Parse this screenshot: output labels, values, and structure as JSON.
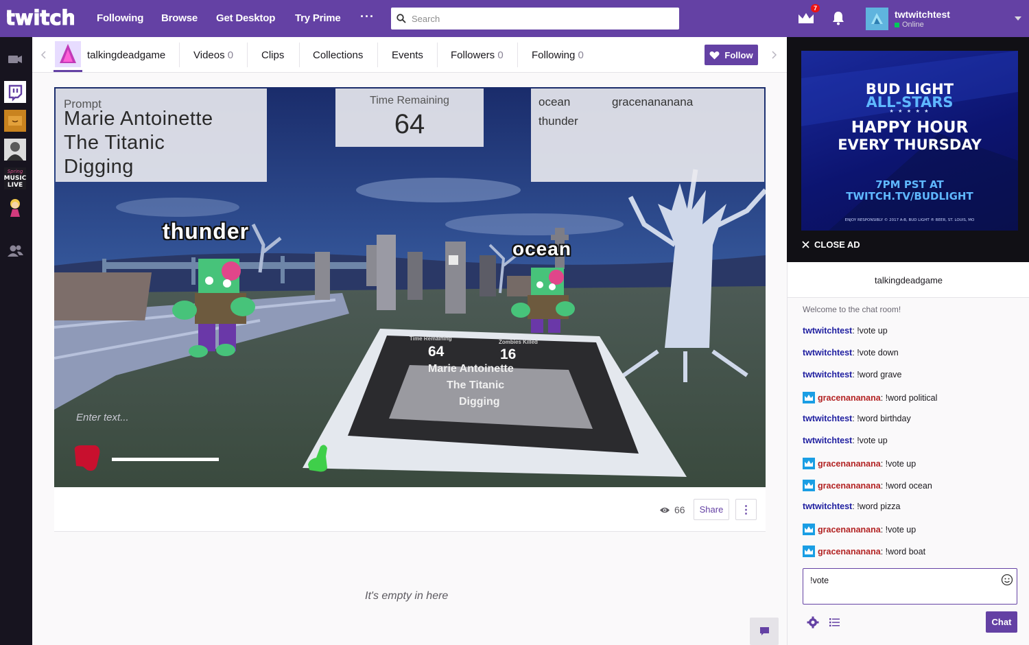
{
  "topnav": {
    "logo_text": "twitch",
    "links": [
      "Following",
      "Browse",
      "Get Desktop",
      "Try Prime"
    ],
    "more": "···",
    "search_placeholder": "Search",
    "notification_count": "7",
    "username": "twtwitchtest",
    "status": "Online"
  },
  "rail": {
    "items": [
      "video-camera-icon",
      "twitch-glitch-icon",
      "channel-avatar-1",
      "channel-avatar-2",
      "music-live-avatar",
      "channel-avatar-3",
      "friends-icon"
    ],
    "music_live_text": [
      "Spring",
      "MUSIC",
      "LIVE"
    ]
  },
  "channel": {
    "name": "talkingdeadgame",
    "tabs": [
      {
        "label": "Videos",
        "count": "0"
      },
      {
        "label": "Clips",
        "count": ""
      },
      {
        "label": "Collections",
        "count": ""
      },
      {
        "label": "Events",
        "count": ""
      },
      {
        "label": "Followers",
        "count": "0"
      },
      {
        "label": "Following",
        "count": "0"
      }
    ],
    "follow_label": "Follow"
  },
  "game": {
    "prompt_label": "Prompt",
    "prompt_lines": [
      "Marie Antoinette",
      "The Titanic",
      "Digging"
    ],
    "time_label": "Time Remaining",
    "time_value": "64",
    "players": [
      "ocean",
      "gracenananana",
      "thunder"
    ],
    "word_left": "thunder",
    "word_right": "ocean",
    "board": {
      "time_label": "Time Remaining",
      "kills_label": "Zombies Killed",
      "time_value": "64",
      "kills_value": "16",
      "lines": [
        "Marie Antoinette",
        "The Titanic",
        "Digging"
      ]
    },
    "enter_placeholder": "Enter text..."
  },
  "player_bar": {
    "viewers": "66",
    "share_label": "Share",
    "more_label": "⋮"
  },
  "below_player": {
    "empty_text": "It's empty in here"
  },
  "ad": {
    "line1": "BUD LIGHT",
    "line2": "ALL-STARS",
    "stars": "★ ★ ★ ★ ★",
    "line3": "HAPPY HOUR",
    "line4": "EVERY THURSDAY",
    "line5": "7PM PST AT",
    "line6": "TWITCH.TV/BUDLIGHT",
    "fine_print": "ENJOY RESPONSIBLY © 2017 A-B, BUD LIGHT ® BEER, ST. LOUIS, MO",
    "close_label": "CLOSE AD"
  },
  "chat": {
    "title": "talkingdeadgame",
    "welcome": "Welcome to the chat room!",
    "messages": [
      {
        "user": "twtwitchtest",
        "text": "!vote up",
        "badge": false,
        "color": "#1e1ea0"
      },
      {
        "user": "twtwitchtest",
        "text": "!vote down",
        "badge": false,
        "color": "#1e1ea0"
      },
      {
        "user": "twtwitchtest",
        "text": "!word grave",
        "badge": false,
        "color": "#1e1ea0"
      },
      {
        "user": "gracenananana",
        "text": "!word political",
        "badge": true,
        "color": "#b22222"
      },
      {
        "user": "twtwitchtest",
        "text": "!word birthday",
        "badge": false,
        "color": "#1e1ea0"
      },
      {
        "user": "twtwitchtest",
        "text": "!vote up",
        "badge": false,
        "color": "#1e1ea0"
      },
      {
        "user": "gracenananana",
        "text": "!vote up",
        "badge": true,
        "color": "#b22222"
      },
      {
        "user": "gracenananana",
        "text": "!word ocean",
        "badge": true,
        "color": "#b22222"
      },
      {
        "user": "twtwitchtest",
        "text": "!word pizza",
        "badge": false,
        "color": "#1e1ea0"
      },
      {
        "user": "gracenananana",
        "text": "!vote up",
        "badge": true,
        "color": "#b22222"
      },
      {
        "user": "gracenananana",
        "text": "!word boat",
        "badge": true,
        "color": "#b22222"
      }
    ],
    "input_value": "!vote",
    "send_label": "Chat"
  },
  "colors": {
    "brand": "#6441a4",
    "rail": "#17141f",
    "ad_background": "#111015"
  }
}
